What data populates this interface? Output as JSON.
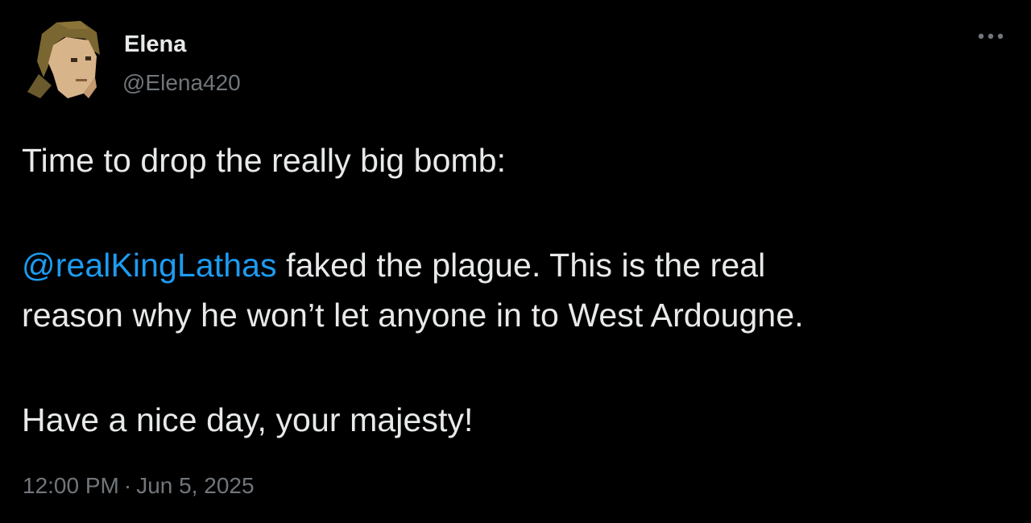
{
  "author": {
    "display_name": "Elena",
    "handle": "@Elena420",
    "avatar_icon": "character-avatar"
  },
  "more_icon": "more-horizontal-icon",
  "tweet": {
    "line1": "Time to drop the really big bomb:",
    "mention": "@realKingLathas",
    "line2_rest": " faked the plague. This is the real",
    "line3": "reason why he won’t let anyone in to West Ardougne.",
    "line4": "Have a nice day, your majesty!"
  },
  "meta": {
    "time": "12:00 PM",
    "separator": "·",
    "date": "Jun 5, 2025"
  },
  "colors": {
    "background": "#000000",
    "text": "#e7e9ea",
    "secondary": "#71767b",
    "link": "#1d9bf0"
  }
}
